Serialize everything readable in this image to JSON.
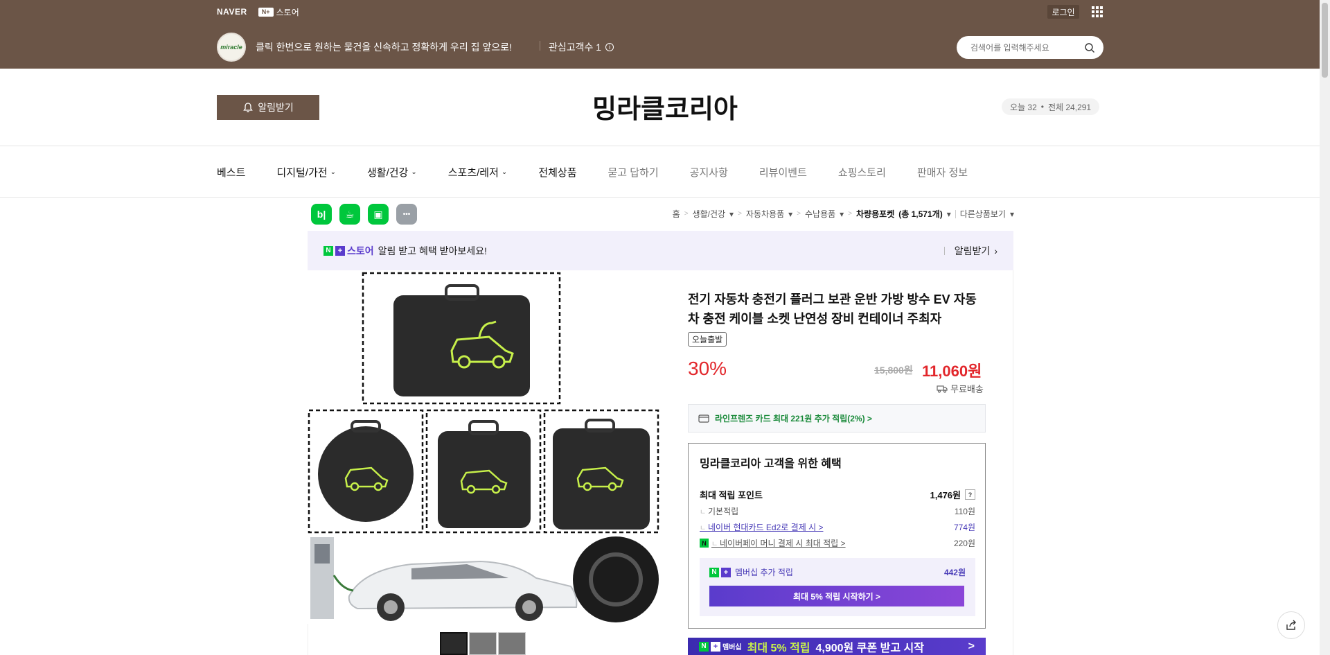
{
  "gnb": {
    "naver_label": "NAVER",
    "nplus_label": "N+",
    "store_label": "스토어",
    "login_label": "로그인"
  },
  "store_bar": {
    "avatar_text": "miracle",
    "slogan": "클릭 한번으로 원하는 물건을 신속하고 정확하게 우리 집 앞으로!",
    "interest_label": "관심고객수 1",
    "search_placeholder": "검색어를 입력해주세요"
  },
  "header": {
    "alarm_label": "알림받기",
    "store_title": "밍라클코리아",
    "today_visitors": "오늘 32",
    "total_visitors": "전체 24,291"
  },
  "nav": {
    "items": [
      {
        "label": "베스트"
      },
      {
        "label": "디지털/가전"
      },
      {
        "label": "생활/건강"
      },
      {
        "label": "스포츠/레저"
      },
      {
        "label": "전체상품"
      },
      {
        "label": "묻고 답하기"
      },
      {
        "label": "공지사항"
      },
      {
        "label": "리뷰이벤트"
      },
      {
        "label": "쇼핑스토리"
      },
      {
        "label": "판매자 정보"
      }
    ]
  },
  "share": {
    "blog": "b|",
    "cafe": "☕",
    "bookmark": "▣",
    "more": "•••"
  },
  "breadcrumb": {
    "home": "홈",
    "c1": "생활/건강",
    "c2": "자동차용품",
    "c3": "수납용품",
    "c4": "차량용포켓",
    "c4_count": "(총 1,571개)",
    "other": "다른상품보기"
  },
  "banner": {
    "brand": "스토어",
    "text": "알림 받고 혜택 받아보세요!",
    "action": "알림받기"
  },
  "product": {
    "title": "전기 자동차 충전기 플러그 보관 운반 가방 방수 EV 자동차 충전 케이블 소켓 난연성 장비 컨테이너 주최자",
    "badge": "오늘출발",
    "discount": "30%",
    "original_price": "15,800원",
    "sale_price": "11,060원",
    "shipping": "무료배송",
    "card_benefit": "라인프렌즈 카드 최대 221원 추가 적립(2%) >"
  },
  "benefit": {
    "title": "밍라클코리아 고객을 위한 혜택",
    "max_points_label": "최대 적립 포인트",
    "max_points_value": "1,476원",
    "help": "?",
    "rows": [
      {
        "label": "기본적립",
        "value": "110원"
      },
      {
        "label": "네이버 현대카드 Ed2로 결제 시 >",
        "value": "774원"
      },
      {
        "label": "네이버페이 머니 결제 시 최대 적립 >",
        "value": "220원"
      }
    ],
    "npay_badge": "N",
    "member_label": "멤버십 추가 적립",
    "member_value": "442원",
    "member_button": "최대 5% 적립 시작하기 >"
  },
  "coupon": {
    "badge": "멤버십",
    "highlight": "최대 5% 적립",
    "text": "4,900원 쿠폰 받고 시작",
    "arrow": ">"
  },
  "colors": {
    "brand_brown": "#6b5547",
    "price_red": "#e2262b",
    "naver_green": "#00c73c",
    "membership_purple": "#5a3ccc"
  },
  "icons": [
    "bell-icon",
    "search-icon",
    "apps-grid-icon",
    "info-icon",
    "card-icon",
    "truck-icon",
    "share-icon"
  ]
}
